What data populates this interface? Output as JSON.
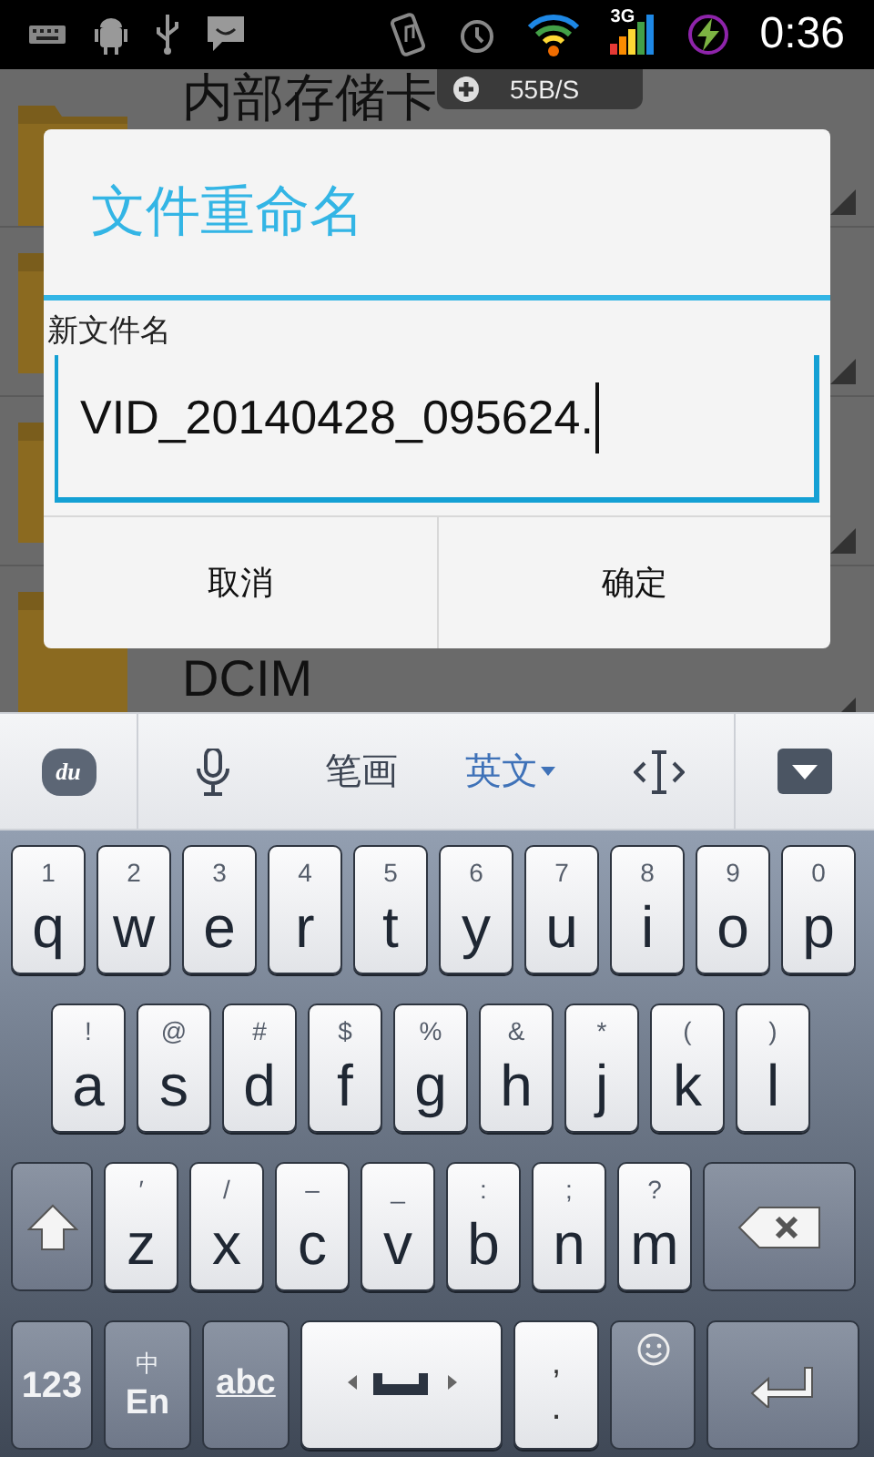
{
  "status_bar": {
    "network": "3G",
    "time": "0:36",
    "speed": "55B/S"
  },
  "file_list": [
    {
      "kind": "folder",
      "name": "内部存储卡"
    },
    {
      "kind": "folder"
    },
    {
      "kind": "folder"
    },
    {
      "kind": "folder",
      "name": "DCIM"
    }
  ],
  "dialog": {
    "title": "文件重命名",
    "label": "新文件名",
    "value": "VID_20140428_095624.",
    "buttons": [
      "取消",
      "确定"
    ]
  },
  "keyboard": {
    "toolbar": [
      {
        "kind": "logo",
        "label": "du",
        "selected": false
      },
      {
        "kind": "mic",
        "selected": false
      },
      {
        "kind": "text",
        "label": "笔画",
        "selected": false
      },
      {
        "kind": "text",
        "label": "英文",
        "selected": true
      },
      {
        "kind": "cursor",
        "selected": false
      },
      {
        "kind": "hide",
        "selected": false
      }
    ],
    "rows": [
      [
        {
          "label": "q",
          "sub": "1"
        },
        {
          "label": "w",
          "sub": "2"
        },
        {
          "label": "e",
          "sub": "3"
        },
        {
          "label": "r",
          "sub": "4"
        },
        {
          "label": "t",
          "sub": "5"
        },
        {
          "label": "y",
          "sub": "6"
        },
        {
          "label": "u",
          "sub": "7"
        },
        {
          "label": "i",
          "sub": "8"
        },
        {
          "label": "o",
          "sub": "9"
        },
        {
          "label": "p",
          "sub": "0"
        }
      ],
      [
        {
          "label": "a",
          "sub": "!"
        },
        {
          "label": "s",
          "sub": "@"
        },
        {
          "label": "d",
          "sub": "#"
        },
        {
          "label": "f",
          "sub": "$"
        },
        {
          "label": "g",
          "sub": "%"
        },
        {
          "label": "h",
          "sub": "&"
        },
        {
          "label": "j",
          "sub": "*"
        },
        {
          "label": "k",
          "sub": "("
        },
        {
          "label": "l",
          "sub": ")"
        }
      ],
      [
        {
          "kind": "shift"
        },
        {
          "label": "z",
          "sub": "′"
        },
        {
          "label": "x",
          "sub": "/"
        },
        {
          "label": "c",
          "sub": "–"
        },
        {
          "label": "v",
          "sub": "_"
        },
        {
          "label": "b",
          "sub": ":"
        },
        {
          "label": "n",
          "sub": ";"
        },
        {
          "label": "m",
          "sub": "?"
        },
        {
          "kind": "backspace"
        }
      ],
      [
        {
          "kind": "mode",
          "label": "123"
        },
        {
          "kind": "lang",
          "label": "En",
          "sub": "中"
        },
        {
          "kind": "abc",
          "label": "abc"
        },
        {
          "kind": "space"
        },
        {
          "kind": "punct",
          "label": ".",
          "sub": ","
        },
        {
          "kind": "emoji"
        },
        {
          "kind": "enter"
        }
      ]
    ]
  }
}
